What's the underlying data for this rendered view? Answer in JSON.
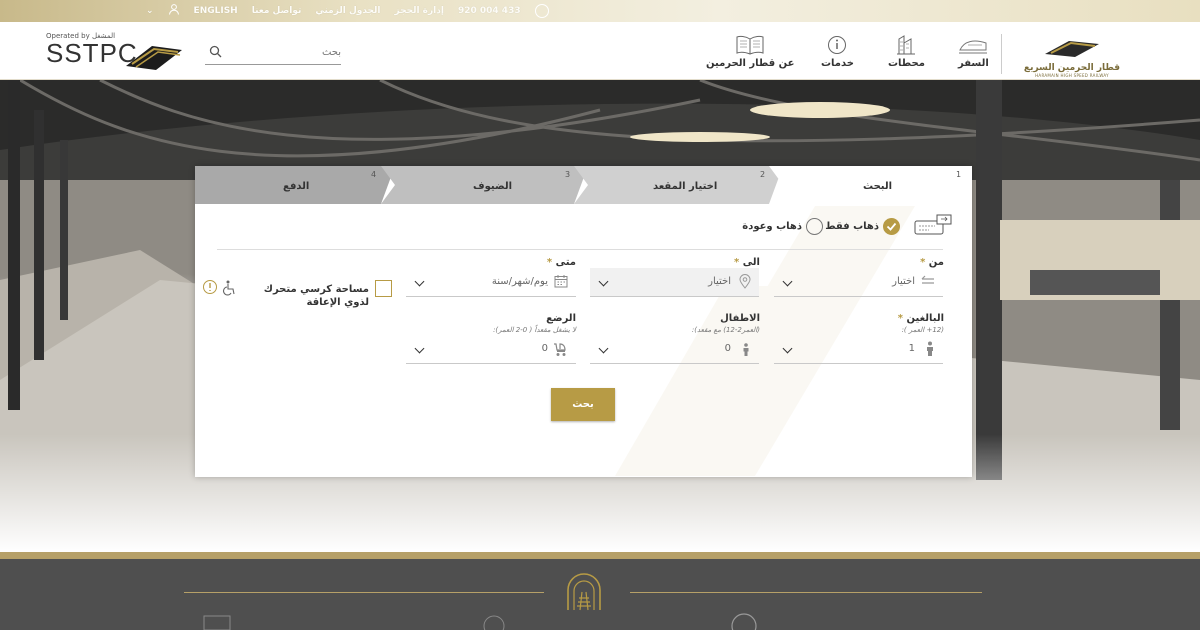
{
  "topbar": {
    "language": "ENGLISH",
    "contact": "تواصل معنا",
    "timetable": "الجدول الزمني",
    "booking_mgmt": "إدارة الحجز",
    "phone": "920 004 433"
  },
  "header": {
    "operated_by": "Operated by المشغل",
    "operator_name": "SSTPC",
    "search_placeholder": "بحث",
    "nav": {
      "travel": "السفر",
      "stations": "محطات",
      "services": "خدمات",
      "about": "عن قطار الحرمين"
    },
    "brand_ar": "قطار الحرمين السريع",
    "brand_en": "HARAMAIN HIGH SPEED RAILWAY"
  },
  "tabs": [
    {
      "num": "1",
      "label": "البحث"
    },
    {
      "num": "2",
      "label": "اختيار المقعد"
    },
    {
      "num": "3",
      "label": "الضيوف"
    },
    {
      "num": "4",
      "label": "الدفع"
    }
  ],
  "trip_type": {
    "one_way": "ذهاب فقط",
    "round_trip": "ذهاب وعودة"
  },
  "form": {
    "from_label": "من",
    "from_value": "اختيار",
    "to_label": "الى",
    "to_value": "اختيار",
    "when_label": "متى",
    "when_value": "يوم/شهر/سنة",
    "adults_label": "البالغين",
    "adults_sub": "(12+ العمر ):",
    "adults_value": "1",
    "children_label": "الاطفال",
    "children_sub": "(العمر2-12) مع مقعد):",
    "children_value": "0",
    "infants_label": "الرضع",
    "infants_sub": "لا يشغل مقعداً ( 0-2 العمر):",
    "infants_value": "0",
    "required": "*",
    "wheelchair": "مساحة كرسي متحرك لذوي الإعاقة",
    "search_button": "بحث"
  },
  "colors": {
    "accent": "#b79b45",
    "footer": "#4f4f4f"
  }
}
